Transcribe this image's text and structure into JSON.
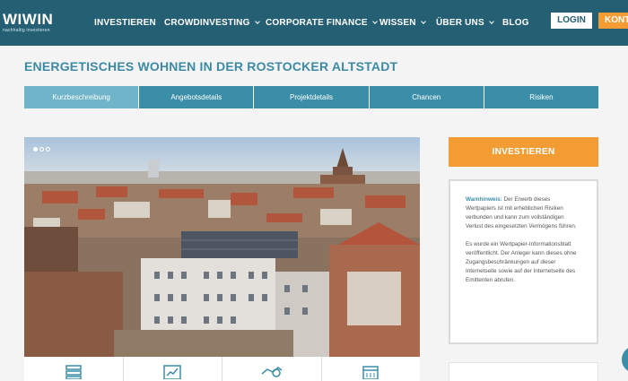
{
  "header": {
    "logo": {
      "name": "WIWIN",
      "tagline": "nachhaltig investieren"
    },
    "nav": [
      {
        "label": "INVESTIEREN",
        "has_dropdown": false
      },
      {
        "label": "CROWDINVESTING",
        "has_dropdown": true
      },
      {
        "label": "CORPORATE FINANCE",
        "has_dropdown": true
      },
      {
        "label": "WISSEN",
        "has_dropdown": true
      },
      {
        "label": "ÜBER UNS",
        "has_dropdown": true
      },
      {
        "label": "BLOG",
        "has_dropdown": false
      }
    ],
    "login_label": "LOGIN",
    "contact_label": "KONTAKT"
  },
  "project": {
    "title": "ENERGETISCHES WOHNEN IN DER ROSTOCKER ALTSTADT"
  },
  "tabs": [
    {
      "label": "Kurzbeschreibung",
      "active": true
    },
    {
      "label": "Angebotsdetails",
      "active": false
    },
    {
      "label": "Projektdetails",
      "active": false
    },
    {
      "label": "Chancen",
      "active": false
    },
    {
      "label": "Risiken",
      "active": false
    }
  ],
  "gallery": {
    "slide_count": 3,
    "active_slide": 1
  },
  "icons": [
    "server-icon",
    "chart-icon",
    "handshake-icon",
    "calendar-icon"
  ],
  "sidebar": {
    "invest_label": "INVESTIEREN",
    "warning": {
      "label": "Warnhinweis:",
      "text": "Der Erwerb dieses Wertpapiers ist mit erheblichen Risiken verbunden und kann zum vollständigen Verlust des eingesetzten Vermögens führen.",
      "notice": "Es wurde ein Wertpapier-Informationsblatt veröffentlicht. Der Anleger kann dieses ohne Zugangsbeschränkungen auf dieser Internetseite sowie auf der Internetseite des Emittenten abrufen."
    }
  },
  "colors": {
    "header_bg": "#245f73",
    "accent_orange": "#f39c34",
    "tab_blue": "#3b8ea7",
    "tab_active": "#6fb4c8",
    "title_blue": "#3d8aa6"
  }
}
